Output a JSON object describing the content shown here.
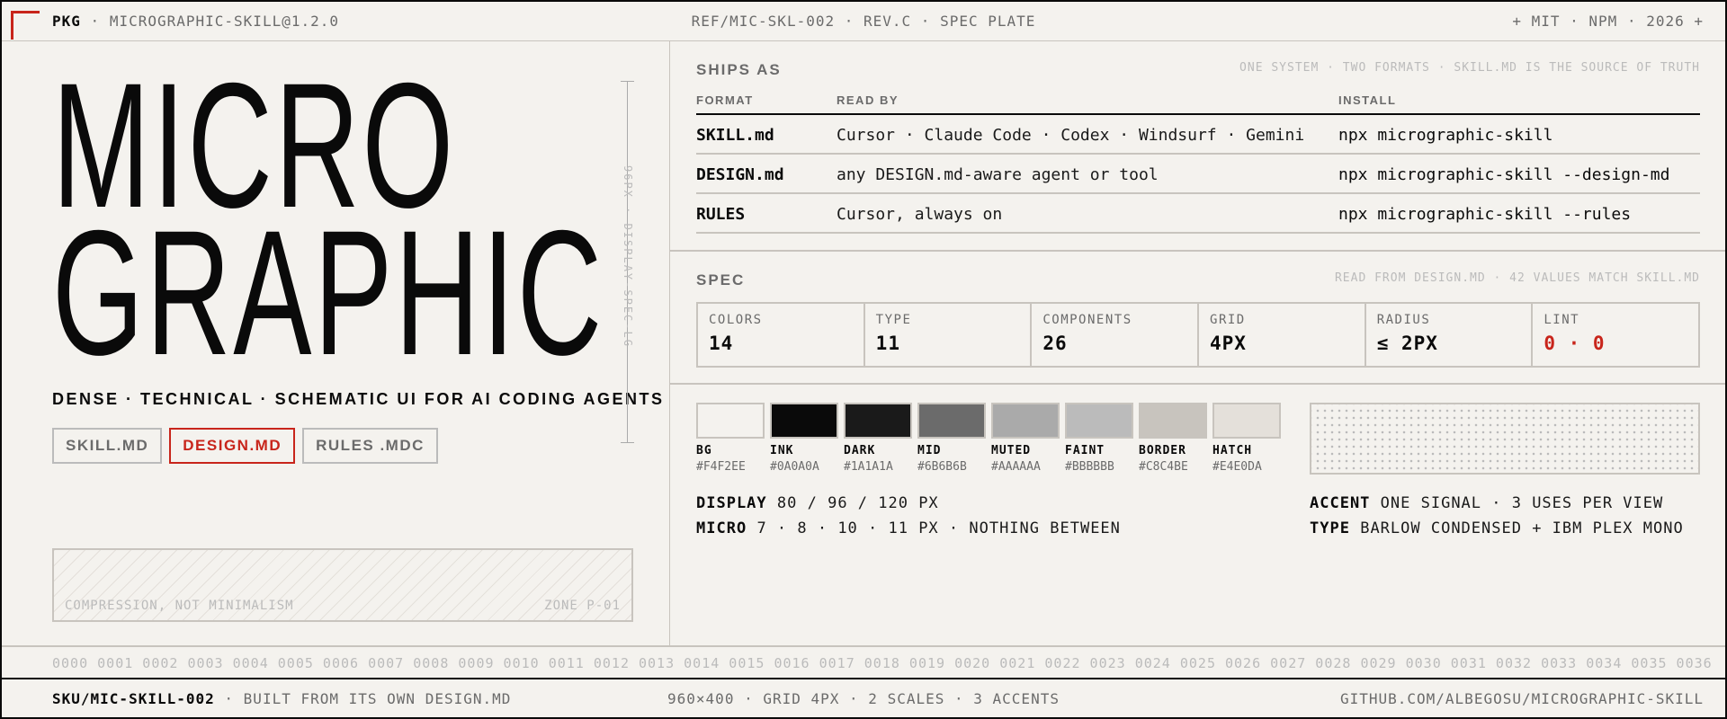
{
  "topbar": {
    "pkg_label": "PKG",
    "sep": " · ",
    "pkg_name": "MICROGRAPHIC-SKILL@1.2.0",
    "center": "REF/MIC-SKL-002 · REV.C · SPEC PLATE",
    "right": "+ MIT · NPM · 2026 +"
  },
  "hero": {
    "line1": "MICRO",
    "line2": "GRAPHIC",
    "tagline": "DENSE · TECHNICAL · SCHEMATIC UI FOR AI CODING AGENTS",
    "scale_label": "96PX · DISPLAY-SPEC-LG",
    "buttons": [
      "SKILL.MD",
      "DESIGN.MD",
      "RULES .MDC"
    ],
    "active_button": "DESIGN.MD"
  },
  "zone": {
    "left": "COMPRESSION, NOT MINIMALISM",
    "right": "ZONE P-01"
  },
  "ships": {
    "title": "SHIPS AS",
    "note": "ONE SYSTEM · TWO FORMATS · SKILL.MD IS THE SOURCE OF TRUTH",
    "headers": [
      "FORMAT",
      "READ BY",
      "INSTALL"
    ],
    "rows": [
      [
        "SKILL.md",
        "Cursor · Claude Code · Codex · Windsurf · Gemini",
        "npx micrographic-skill"
      ],
      [
        "DESIGN.md",
        "any DESIGN.md-aware agent or tool",
        "npx micrographic-skill --design-md"
      ],
      [
        "RULES",
        "Cursor, always on",
        "npx micrographic-skill --rules"
      ]
    ]
  },
  "spec": {
    "title": "SPEC",
    "note": "READ FROM DESIGN.MD · 42 VALUES MATCH SKILL.MD",
    "cells": [
      {
        "k": "COLORS",
        "v": "14"
      },
      {
        "k": "TYPE",
        "v": "11"
      },
      {
        "k": "COMPONENTS",
        "v": "26"
      },
      {
        "k": "GRID",
        "v": "4PX"
      },
      {
        "k": "RADIUS",
        "v": "≤ 2PX"
      },
      {
        "k": "LINT",
        "v": "0 · 0"
      }
    ]
  },
  "swatches": [
    {
      "name": "BG",
      "hex": "#F4F2EE"
    },
    {
      "name": "INK",
      "hex": "#0A0A0A"
    },
    {
      "name": "DARK",
      "hex": "#1A1A1A"
    },
    {
      "name": "MID",
      "hex": "#6B6B6B"
    },
    {
      "name": "MUTED",
      "hex": "#AAAAAA"
    },
    {
      "name": "FAINT",
      "hex": "#BBBBBB"
    },
    {
      "name": "BORDER",
      "hex": "#C8C4BE"
    },
    {
      "name": "HATCH",
      "hex": "#E4E0DA"
    }
  ],
  "typespec": {
    "display_k": "DISPLAY",
    "display_v": "80 / 96 / 120 PX",
    "micro_k": "MICRO",
    "micro_v": "7 · 8 · 10 · 11 PX · NOTHING BETWEEN",
    "accent_k": "ACCENT",
    "accent_v": "ONE SIGNAL · 3 USES PER VIEW",
    "type_k": "TYPE",
    "type_v": "BARLOW CONDENSED + IBM PLEX MONO"
  },
  "index_strip": "0000 0001 0002 0003 0004 0005 0006 0007 0008 0009 0010 0011 0012 0013 0014 0015 0016 0017 0018 0019 0020 0021 0022 0023 0024 0025 0026 0027 0028 0029 0030 0031 0032 0033 0034 0035 0036",
  "footer": {
    "sku": "SKU/MIC-SKILL-002",
    "sep": " · ",
    "built": "BUILT FROM ITS OWN DESIGN.MD",
    "center": "960×400 · GRID 4PX · 2 SCALES · 3 ACCENTS",
    "right": "GITHUB.COM/ALBEGOSU/MICROGRAPHIC-SKILL"
  },
  "colors": {
    "accent": "#C8251B",
    "ink": "#0A0A0A",
    "bg": "#F4F2EE",
    "border": "#C8C4BE"
  }
}
